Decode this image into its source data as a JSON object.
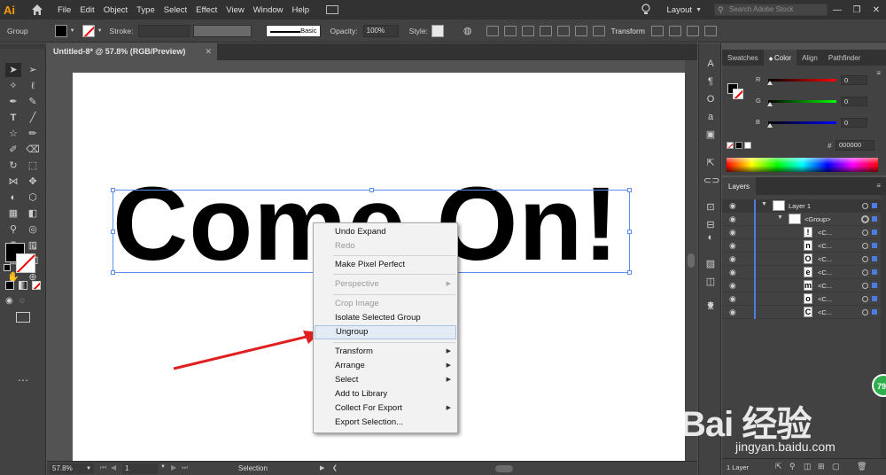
{
  "app": {
    "logo": "Ai"
  },
  "menubar": {
    "items": [
      "File",
      "Edit",
      "Object",
      "Type",
      "Select",
      "Effect",
      "View",
      "Window",
      "Help"
    ],
    "layout_label": "Layout",
    "search_placeholder": "Search Adobe Stock"
  },
  "controlbar": {
    "selection_type": "Group",
    "stroke_label": "Stroke:",
    "brush_label": "Basic",
    "opacity_label": "Opacity:",
    "opacity_value": "100%",
    "style_label": "Style:",
    "transform_label": "Transform"
  },
  "document": {
    "tab_title": "Untitled-8* @ 57.8% (RGB/Preview)",
    "artwork_text": "Come On!"
  },
  "context_menu": {
    "items": [
      {
        "label": "Undo Expand",
        "enabled": true
      },
      {
        "label": "Redo",
        "enabled": false
      },
      {
        "label": "Make Pixel Perfect",
        "enabled": true
      },
      {
        "label": "Perspective",
        "enabled": false,
        "submenu": true
      },
      {
        "label": "Crop Image",
        "enabled": false
      },
      {
        "label": "Isolate Selected Group",
        "enabled": true
      },
      {
        "label": "Ungroup",
        "enabled": true,
        "highlighted": true
      },
      {
        "label": "Transform",
        "enabled": true,
        "submenu": true
      },
      {
        "label": "Arrange",
        "enabled": true,
        "submenu": true
      },
      {
        "label": "Select",
        "enabled": true,
        "submenu": true
      },
      {
        "label": "Add to Library",
        "enabled": true
      },
      {
        "label": "Collect For Export",
        "enabled": true,
        "submenu": true
      },
      {
        "label": "Export Selection...",
        "enabled": true
      }
    ]
  },
  "statusbar": {
    "zoom": "57.8%",
    "artboard_number": "1",
    "status_text": "Selection"
  },
  "color_panel": {
    "tabs": [
      "Swatches",
      "Color",
      "Align",
      "Pathfinder"
    ],
    "active_tab": "Color",
    "sliders": [
      {
        "label": "R",
        "value": "0"
      },
      {
        "label": "G",
        "value": "0"
      },
      {
        "label": "B",
        "value": "0"
      }
    ],
    "hex_symbol": "#",
    "hex_value": "000000"
  },
  "layers_panel": {
    "title": "Layers",
    "rows": [
      {
        "name": "Layer 1",
        "type": "layer",
        "glyph": ""
      },
      {
        "name": "<Group>",
        "type": "group",
        "glyph": ""
      },
      {
        "name": "<C...",
        "type": "path",
        "glyph": "!"
      },
      {
        "name": "<C...",
        "type": "path",
        "glyph": "n"
      },
      {
        "name": "<C...",
        "type": "path",
        "glyph": "O"
      },
      {
        "name": "<C...",
        "type": "path",
        "glyph": "e"
      },
      {
        "name": "<C...",
        "type": "path",
        "glyph": "m"
      },
      {
        "name": "<C...",
        "type": "path",
        "glyph": "o"
      },
      {
        "name": "<C...",
        "type": "path",
        "glyph": "C"
      }
    ],
    "layer_count": "1 Layer"
  },
  "watermark": {
    "main": "Bai 经验",
    "sub": "jingyan.baidu.com"
  },
  "badge": {
    "value": "79"
  },
  "colors": {
    "accent": "#4d7be0",
    "selection": "#5b8ef0",
    "arrow": "#e02020"
  }
}
